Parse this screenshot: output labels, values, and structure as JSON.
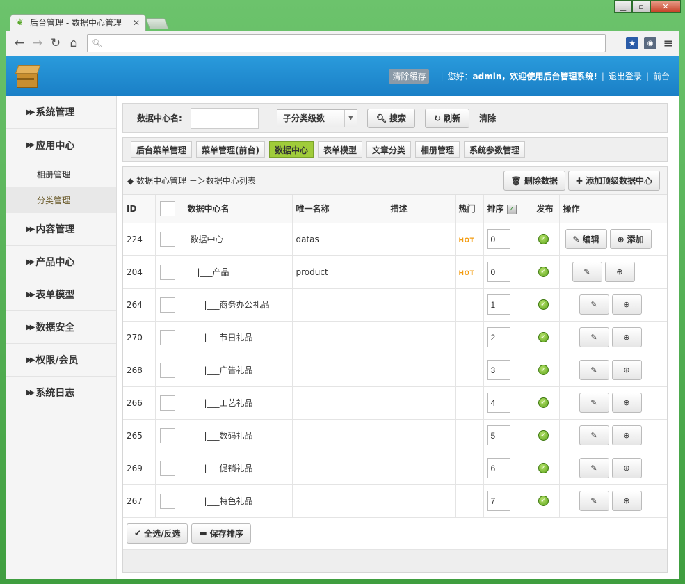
{
  "browser": {
    "tab_title": "后台管理 - 数据中心管理",
    "close_glyph": "✕",
    "address_value": "",
    "window_controls": [
      "▁",
      "▫",
      "✕"
    ]
  },
  "header": {
    "clear_cache": "清除缓存",
    "greeting_prefix": "您好：",
    "user": "admin",
    "greeting_suffix": "，欢迎使用后台管理系统!",
    "logout": "退出登录",
    "frontend": "前台"
  },
  "sidebar": {
    "items": [
      {
        "label": "系统管理"
      },
      {
        "label": "应用中心"
      },
      {
        "label": "相册管理"
      },
      {
        "label": "分类管理"
      },
      {
        "label": "内容管理"
      },
      {
        "label": "产品中心"
      },
      {
        "label": "表单模型"
      },
      {
        "label": "数据安全"
      },
      {
        "label": "权限/会员"
      },
      {
        "label": "系统日志"
      }
    ]
  },
  "search": {
    "label": "数据中心名:",
    "input_value": "",
    "select_value": "子分类级数",
    "search_btn": "搜索",
    "refresh_btn": "刷新",
    "clear_link": "清除"
  },
  "tabs": [
    {
      "label": "后台菜单管理"
    },
    {
      "label": "菜单管理(前台)"
    },
    {
      "label": "数据中心"
    },
    {
      "label": "表单模型"
    },
    {
      "label": "文章分类"
    },
    {
      "label": "相册管理"
    },
    {
      "label": "系统参数管理"
    }
  ],
  "panel": {
    "breadcrumb": "◆ 数据中心管理 －＞数据中心列表",
    "delete_btn": "删除数据",
    "add_top_btn": "添加顶级数据中心",
    "columns": [
      "ID",
      "",
      "数据中心名",
      "唯一名称",
      "描述",
      "热门",
      "排序",
      "发布",
      "操作"
    ],
    "hot_label": "HOT",
    "edit_label": "编辑",
    "add_label": "添加",
    "rows": [
      {
        "id": "224",
        "name": "数据中心",
        "unique": "datas",
        "desc": "",
        "hot": true,
        "sort": "0"
      },
      {
        "id": "204",
        "name": "|___产品",
        "unique": "product",
        "desc": "",
        "hot": true,
        "sort": "0"
      },
      {
        "id": "264",
        "name": "|___商务办公礼品",
        "unique": "",
        "desc": "",
        "hot": false,
        "sort": "1"
      },
      {
        "id": "270",
        "name": "|___节日礼品",
        "unique": "",
        "desc": "",
        "hot": false,
        "sort": "2"
      },
      {
        "id": "268",
        "name": "|___广告礼品",
        "unique": "",
        "desc": "",
        "hot": false,
        "sort": "3"
      },
      {
        "id": "266",
        "name": "|___工艺礼品",
        "unique": "",
        "desc": "",
        "hot": false,
        "sort": "4"
      },
      {
        "id": "265",
        "name": "|___数码礼品",
        "unique": "",
        "desc": "",
        "hot": false,
        "sort": "5"
      },
      {
        "id": "269",
        "name": "|___促销礼品",
        "unique": "",
        "desc": "",
        "hot": false,
        "sort": "6"
      },
      {
        "id": "267",
        "name": "|___特色礼品",
        "unique": "",
        "desc": "",
        "hot": false,
        "sort": "7"
      }
    ],
    "select_all_btn": "全选/反选",
    "save_sort_btn": "保存排序"
  }
}
